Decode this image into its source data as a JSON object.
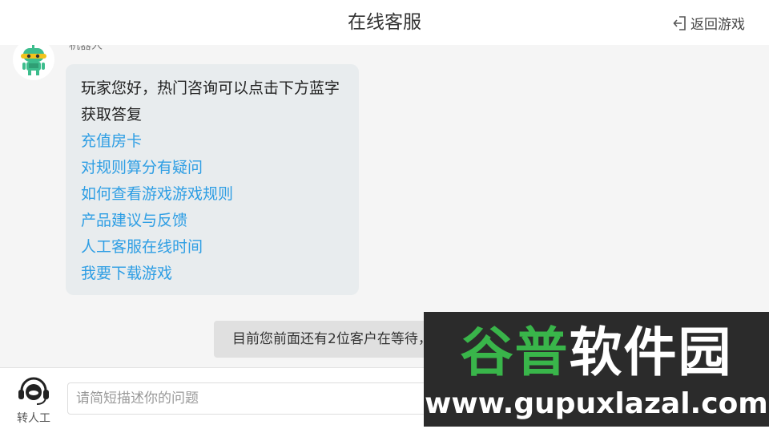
{
  "header": {
    "title": "在线客服",
    "back_label": "返回游戏"
  },
  "bot": {
    "name": "机器人"
  },
  "message": {
    "intro": "玩家您好，热门咨询可以点击下方蓝字获取答复",
    "links": [
      "充值房卡",
      "对规则算分有疑问",
      "如何查看游戏游戏规则",
      "产品建议与反馈",
      "人工客服在线时间",
      "我要下载游戏"
    ]
  },
  "queue_notice": "目前您前面还有2位客户在等待，请耐等...",
  "composer": {
    "agent_label": "转人工",
    "placeholder": "请简短描述你的问题"
  },
  "watermark": {
    "logo_green": "谷普",
    "logo_white": "软件园",
    "url": "www.gupuxlazal.com"
  },
  "colors": {
    "link": "#2e9ee4",
    "bubble": "#e8ecee",
    "robot_green": "#3dbd8d"
  }
}
